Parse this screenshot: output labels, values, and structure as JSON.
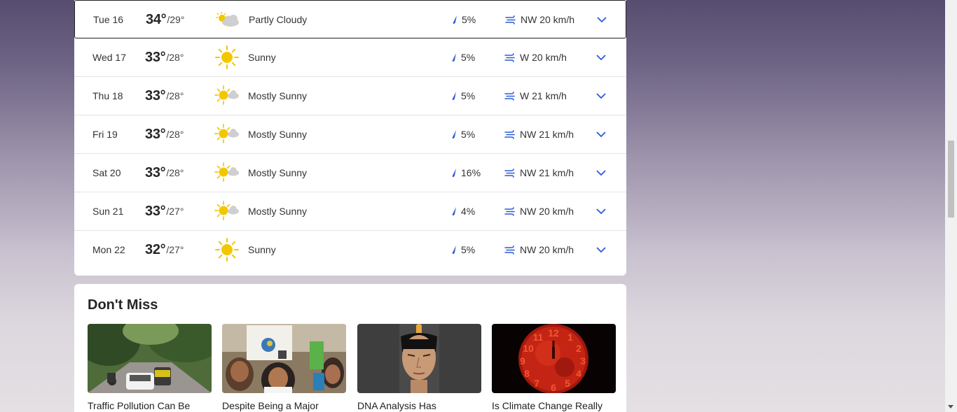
{
  "forecast": [
    {
      "day": "Tue 16",
      "hi": "34°",
      "lo": "/29°",
      "icon": "partly-cloudy-icon",
      "condition": "Partly Cloudy",
      "rain": "5%",
      "wind": "NW 20 km/h",
      "selected": true
    },
    {
      "day": "Wed 17",
      "hi": "33°",
      "lo": "/28°",
      "icon": "sunny-icon",
      "condition": "Sunny",
      "rain": "5%",
      "wind": "W 20 km/h"
    },
    {
      "day": "Thu 18",
      "hi": "33°",
      "lo": "/28°",
      "icon": "mostly-sunny-icon",
      "condition": "Mostly Sunny",
      "rain": "5%",
      "wind": "W 21 km/h"
    },
    {
      "day": "Fri 19",
      "hi": "33°",
      "lo": "/28°",
      "icon": "mostly-sunny-icon",
      "condition": "Mostly Sunny",
      "rain": "5%",
      "wind": "NW 21 km/h"
    },
    {
      "day": "Sat 20",
      "hi": "33°",
      "lo": "/28°",
      "icon": "mostly-sunny-icon",
      "condition": "Mostly Sunny",
      "rain": "16%",
      "wind": "NW 21 km/h"
    },
    {
      "day": "Sun 21",
      "hi": "33°",
      "lo": "/27°",
      "icon": "mostly-sunny-icon",
      "condition": "Mostly Sunny",
      "rain": "4%",
      "wind": "NW 20 km/h"
    },
    {
      "day": "Mon 22",
      "hi": "32°",
      "lo": "/27°",
      "icon": "sunny-icon",
      "condition": "Sunny",
      "rain": "5%",
      "wind": "NW 20 km/h"
    }
  ],
  "dont_miss": {
    "title": "Don't Miss",
    "items": [
      {
        "headline": "Traffic Pollution Can Be",
        "image": "traffic-street-photo"
      },
      {
        "headline": "Despite Being a Major",
        "image": "protest-students-photo"
      },
      {
        "headline": "DNA Analysis Has",
        "image": "face-reconstruction-photo"
      },
      {
        "headline": "Is Climate Change Really",
        "image": "red-sun-clock-photo"
      }
    ]
  },
  "colors": {
    "accent": "#2a5bd7",
    "sun": "#f2c700",
    "cloud": "#c9c9c9"
  }
}
